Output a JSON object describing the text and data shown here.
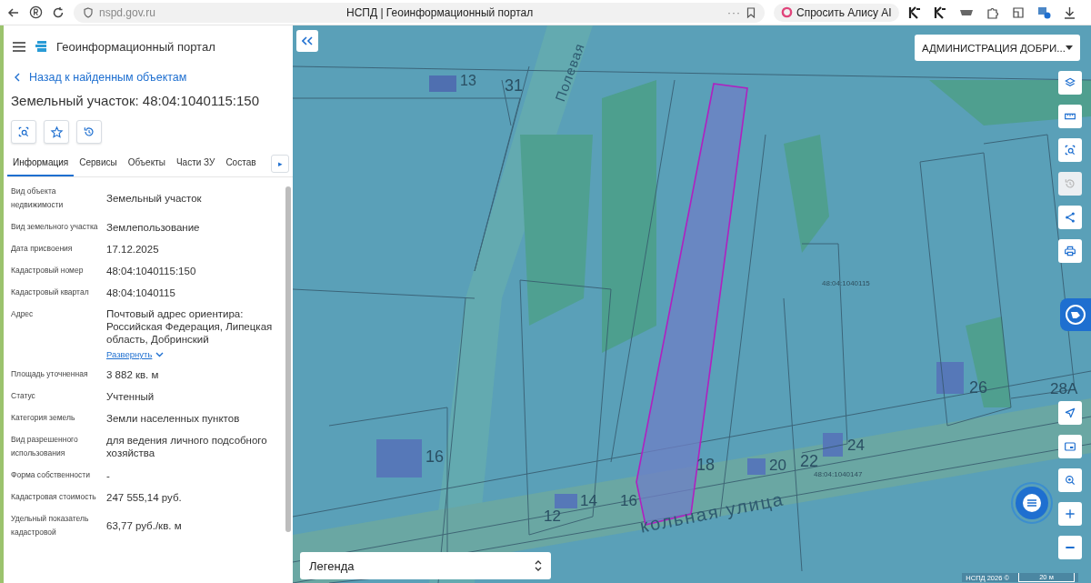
{
  "browser": {
    "url": "nspd.gov.ru",
    "title": "НСПД | Геоинформационный портал",
    "more": "···",
    "assistant": "Спросить Алису AI"
  },
  "panel": {
    "app_title": "Геоинформационный портал",
    "back_link": "Назад к найденным объектам",
    "heading": "Земельный участок: 48:04:1040115:150",
    "tabs": [
      {
        "label": "Информация",
        "selected": true
      },
      {
        "label": "Сервисы",
        "selected": false
      },
      {
        "label": "Объекты",
        "selected": false
      },
      {
        "label": "Части ЗУ",
        "selected": false
      },
      {
        "label": "Состав",
        "selected": false
      }
    ],
    "tab_more": "▸",
    "rows": [
      {
        "label": "Вид объекта недвижимости",
        "value": "Земельный участок"
      },
      {
        "label": "Вид земельного участка",
        "value": "Землепользование"
      },
      {
        "label": "Дата присвоения",
        "value": "17.12.2025"
      },
      {
        "label": "Кадастровый номер",
        "value": "48:04:1040115:150"
      },
      {
        "label": "Кадастровый квартал",
        "value": "48:04:1040115"
      },
      {
        "label": "Адрес",
        "value": "Почтовый адрес ориентира: Российская Федерация, Липецкая область, Добринский",
        "link": "Развернуть"
      },
      {
        "label": "Площадь уточненная",
        "value": "3 882 кв. м"
      },
      {
        "label": "Статус",
        "value": "Учтенный"
      },
      {
        "label": "Категория земель",
        "value": "Земли населенных пунктов"
      },
      {
        "label": "Вид разрешенного использования",
        "value": "для ведения личного подсобного хозяйства"
      },
      {
        "label": "Форма собственности",
        "value": "-"
      },
      {
        "label": "Кадастровая стоимость",
        "value": "247 555,14 руб."
      },
      {
        "label": "Удельный показатель кадастровой",
        "value": "63,77 руб./кв. м"
      }
    ]
  },
  "map": {
    "region_select": "АДМИНИСТРАЦИЯ ДОБРИ...",
    "legend": "Легенда",
    "attribution": "НСПД 2026 ©",
    "scale": "20 м",
    "labels": [
      {
        "text": "13",
        "kind": "house"
      },
      {
        "text": "31",
        "kind": "house"
      },
      {
        "text": "Полевая",
        "kind": "street"
      },
      {
        "text": "48:04:1040115",
        "kind": "quarter"
      },
      {
        "text": "26",
        "kind": "house"
      },
      {
        "text": "28А",
        "kind": "house"
      },
      {
        "text": "16",
        "kind": "house"
      },
      {
        "text": "18",
        "kind": "house"
      },
      {
        "text": "20",
        "kind": "house"
      },
      {
        "text": "22",
        "kind": "house"
      },
      {
        "text": "24",
        "kind": "house"
      },
      {
        "text": "48:04:1040147",
        "kind": "quarter"
      },
      {
        "text": "12",
        "kind": "house"
      },
      {
        "text": "14",
        "kind": "house"
      },
      {
        "text": "16",
        "kind": "house"
      },
      {
        "text": "кольная улица",
        "kind": "street2"
      }
    ],
    "tools": [
      {
        "kind": "layers",
        "disabled": false
      },
      {
        "kind": "ruler",
        "disabled": false
      },
      {
        "kind": "select",
        "disabled": false
      },
      {
        "kind": "history",
        "disabled": true
      },
      {
        "kind": "share",
        "disabled": false
      },
      {
        "kind": "print",
        "disabled": false
      }
    ],
    "nav_tools": [
      {
        "kind": "locate",
        "disabled": false
      },
      {
        "kind": "minimap",
        "disabled": false
      },
      {
        "kind": "search",
        "disabled": false
      },
      {
        "kind": "zoom-in",
        "disabled": false
      },
      {
        "kind": "zoom-out",
        "disabled": false
      }
    ]
  }
}
